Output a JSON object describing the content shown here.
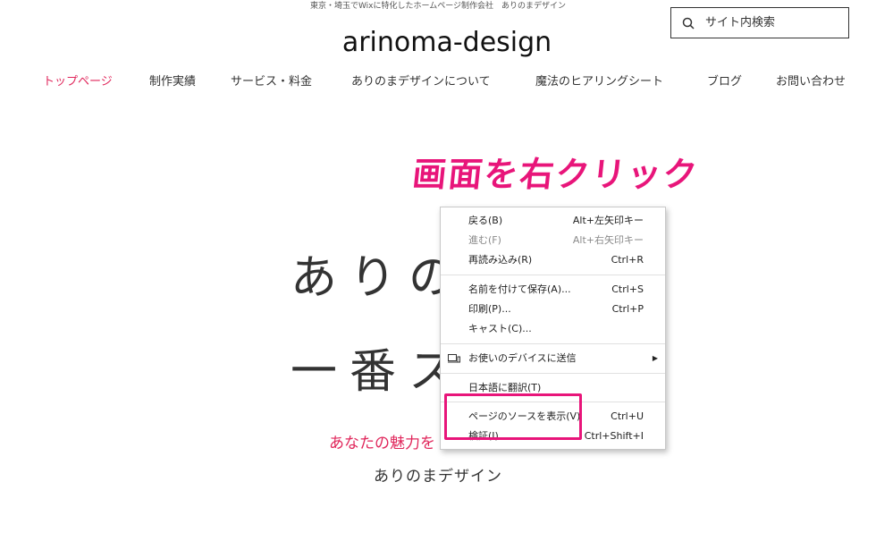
{
  "header": {
    "tagline": "東京・埼玉でWixに特化したホームページ制作会社　ありのまデザイン",
    "logo": "arinoma-design",
    "search_placeholder": "サイト内検索"
  },
  "nav": [
    {
      "label": "トップページ",
      "active": true
    },
    {
      "label": "制作実績",
      "active": false
    },
    {
      "label": "サービス・料金",
      "active": false
    },
    {
      "label": "ありのまデザインについて",
      "active": false
    },
    {
      "label": "魔法のヒアリングシート",
      "active": false
    },
    {
      "label": "ブログ",
      "active": false
    },
    {
      "label": "お問い合わせ",
      "active": false
    }
  ],
  "hero": {
    "annotation": "画面を右クリック",
    "line1": "ありの",
    "line2": "一番ス",
    "tagline_red": "あなたの魅力を",
    "brand": "ありのまデザイン"
  },
  "context_menu": {
    "items": [
      {
        "label": "戻る(B)",
        "shortcut": "Alt+左矢印キー",
        "disabled": false
      },
      {
        "label": "進む(F)",
        "shortcut": "Alt+右矢印キー",
        "disabled": true
      },
      {
        "label": "再読み込み(R)",
        "shortcut": "Ctrl+R",
        "disabled": false
      },
      {
        "label": "名前を付けて保存(A)...",
        "shortcut": "Ctrl+S",
        "disabled": false
      },
      {
        "label": "印刷(P)...",
        "shortcut": "Ctrl+P",
        "disabled": false
      },
      {
        "label": "キャスト(C)...",
        "shortcut": "",
        "disabled": false
      },
      {
        "label": "お使いのデバイスに送信",
        "shortcut": "",
        "disabled": false,
        "submenu": true
      },
      {
        "label": "日本語に翻訳(T)",
        "shortcut": "",
        "disabled": false
      },
      {
        "label": "ページのソースを表示(V)",
        "shortcut": "Ctrl+U",
        "disabled": false
      },
      {
        "label": "検証(I)",
        "shortcut": "Ctrl+Shift+I",
        "disabled": false
      }
    ]
  },
  "colors": {
    "accent": "#e0265b",
    "annotation": "#e8157a"
  }
}
